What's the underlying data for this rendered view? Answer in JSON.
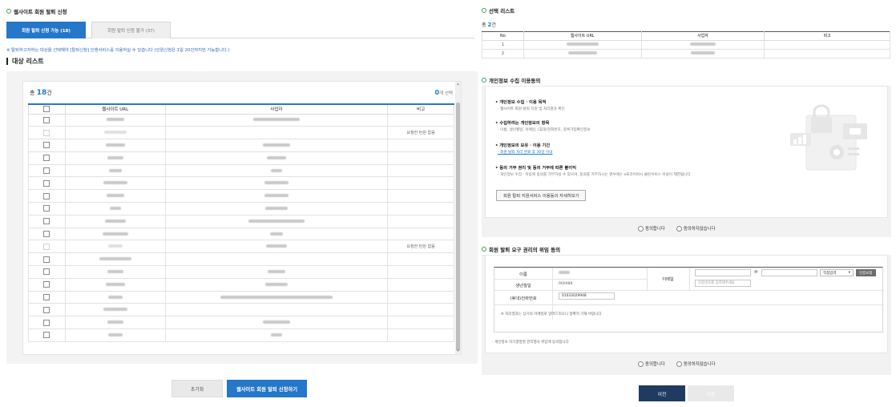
{
  "left": {
    "section_title": "웹사이트 회원 탈퇴 신청",
    "tabs": [
      "회원 탈퇴 신청 가능 (18)",
      "회원 탈퇴 신청 불가 (37)"
    ],
    "notice": "※ 탈퇴하고자하는 대상을 선택해야 [탈퇴신청] 인핸서비스를 이용하실 수 있습니다 (인원신청은 1일 20건까지만 가능합니다.)",
    "list_title": "대상 리스트",
    "count_prefix": "총",
    "count": "18",
    "count_suffix": "건",
    "selected_count": "0",
    "selected_suffix": "개 선택",
    "columns": [
      "웹사이트 URL",
      "사업자",
      "비고"
    ],
    "rows": [
      {
        "note": ""
      },
      {
        "note": "요청한 탄원 없음"
      },
      {
        "note": ""
      },
      {
        "note": ""
      },
      {
        "note": ""
      },
      {
        "note": ""
      },
      {
        "note": ""
      },
      {
        "note": ""
      },
      {
        "note": ""
      },
      {
        "note": ""
      },
      {
        "note": "요청한 탄원 없음"
      },
      {
        "note": ""
      },
      {
        "note": ""
      },
      {
        "note": ""
      },
      {
        "note": ""
      },
      {
        "note": ""
      },
      {
        "note": ""
      },
      {
        "note": ""
      }
    ],
    "reset_label": "초기화",
    "apply_label": "웹사이트 회원 탈퇴 신청하기"
  },
  "right": {
    "selected_title": "선택 리스트",
    "count_prefix": "총",
    "count": "2",
    "count_suffix": "건",
    "sel_columns": [
      "No",
      "웹사이트 URL",
      "사업자",
      "비고"
    ],
    "sel_rows": [
      {
        "no": "1"
      },
      {
        "no": "2"
      }
    ],
    "privacy_title": "개인정보 수집 이용동의",
    "privacy": [
      {
        "h": "• 개인정보 수집 · 이용 목적",
        "d": "- 웹사이트 회원 탈퇴 지원 및 처리결과 확인"
      },
      {
        "h": "• 수집하려는 개인정보의 항목",
        "d": "- 이름, 생년월일, 이메일, (휴대)전화번호, 중복가입확인정보"
      },
      {
        "h": "• 개인정보의 보유 · 이용 기간",
        "d": "- 회원 탈퇴 처리 완료 후 30일 이내"
      },
      {
        "h": "• 동의 거부 권리 및 동의 거부에 따른 불이익",
        "d": "- 개인정보 수집 · 이용에 동의를 거부하실 수 있으며, 동의를 거부하시는 경우에는 e프라이버시 클린서비스 이용이 제한됩니다"
      }
    ],
    "detail_button": "회원 탈퇴 지원서비스 이용동의 자세히보기",
    "agree": "동의합니다",
    "disagree": "동의하지않습니다",
    "claim_title": "회원 탈퇴 요구 권리의 위임 동의",
    "form": {
      "name_label": "이름",
      "birth_label": "생년월일",
      "birth_value": "900988",
      "email_label": "이메일",
      "email_at": "@",
      "domain_select": "직접입력",
      "cert_button": "인증요청",
      "cert_placeholder": "인증번호를 입력해주세요",
      "phone_label": "(휴대)전화번호",
      "phone_value": "01033029948",
      "note": "※ 처리결과는 상기의 이메일로 알려드리오니 정확히 기재 바랍니다"
    },
    "claim_note": "- 개인정보 자기결정권 관리행사 위임에 동의합니다",
    "prev_label": "이전",
    "next_label": "다음"
  },
  "colors": {
    "accent": "#2577c9",
    "section_dot": "#3aa55a",
    "prev_button": "#1f3b62"
  }
}
